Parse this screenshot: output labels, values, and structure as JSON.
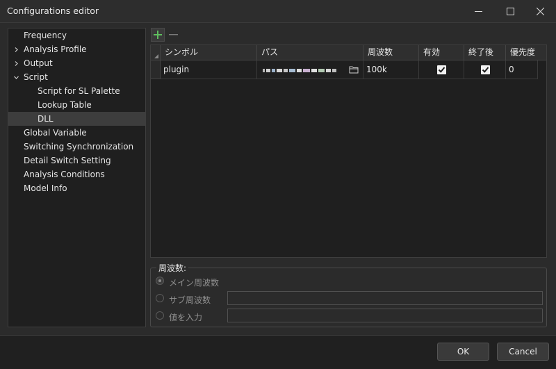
{
  "window": {
    "title": "Configurations editor"
  },
  "nav": {
    "items": [
      {
        "label": "Frequency",
        "expander": "",
        "indent": 0,
        "selected": false
      },
      {
        "label": "Analysis Profile",
        "expander": "collapsed",
        "indent": 0,
        "selected": false
      },
      {
        "label": "Output",
        "expander": "collapsed",
        "indent": 0,
        "selected": false
      },
      {
        "label": "Script",
        "expander": "expanded",
        "indent": 0,
        "selected": false
      },
      {
        "label": "Script for SL Palette",
        "expander": "",
        "indent": 1,
        "selected": false
      },
      {
        "label": "Lookup Table",
        "expander": "",
        "indent": 1,
        "selected": false
      },
      {
        "label": "DLL",
        "expander": "",
        "indent": 1,
        "selected": true
      },
      {
        "label": "Global Variable",
        "expander": "",
        "indent": 0,
        "selected": false
      },
      {
        "label": "Switching Synchronization",
        "expander": "",
        "indent": 0,
        "selected": false
      },
      {
        "label": "Detail Switch Setting",
        "expander": "",
        "indent": 0,
        "selected": false
      },
      {
        "label": "Analysis Conditions",
        "expander": "",
        "indent": 0,
        "selected": false
      },
      {
        "label": "Model Info",
        "expander": "",
        "indent": 0,
        "selected": false
      }
    ]
  },
  "toolbar": {
    "add_icon": "plus-icon",
    "remove_icon": "minus-icon"
  },
  "table": {
    "columns": [
      "シンボル",
      "パス",
      "周波数",
      "有効",
      "終了後",
      "優先度"
    ],
    "rows": [
      {
        "symbol": "plugin",
        "path_obscured": true,
        "frequency": "100k",
        "enabled": true,
        "after_end": true,
        "priority": "0"
      }
    ]
  },
  "frequency_group": {
    "title": "周波数:",
    "options": [
      {
        "label": "メイン周波数",
        "checked": true,
        "has_field": false
      },
      {
        "label": "サブ周波数",
        "checked": false,
        "has_field": true,
        "value": ""
      },
      {
        "label": "値を入力",
        "checked": false,
        "has_field": true,
        "value": ""
      }
    ]
  },
  "buttons": {
    "ok": "OK",
    "cancel": "Cancel"
  },
  "colors": {
    "accent_plus": "#5fbf5f",
    "background": "#2b2b2b",
    "panel": "#1f1f1f",
    "selected_row": "#3d3d3d"
  }
}
